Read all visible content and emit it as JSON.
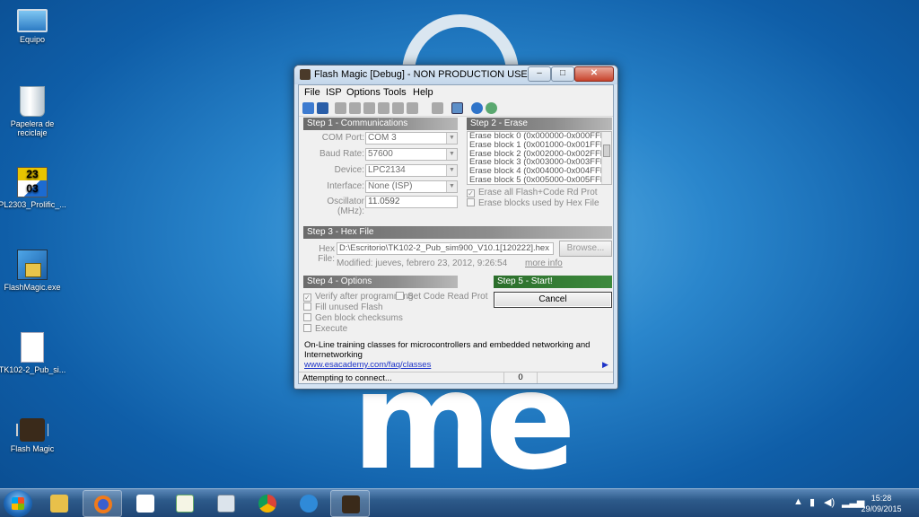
{
  "desktop": {
    "icons": [
      {
        "label": "Equipo"
      },
      {
        "label": "Papelera de reciclaje"
      },
      {
        "label": "PL2303_Prolific_...",
        "calendar_top": "23",
        "calendar_bottom": "03"
      },
      {
        "label": "FlashMagic.exe"
      },
      {
        "label": "TK102-2_Pub_si..."
      },
      {
        "label": "Flash Magic"
      }
    ],
    "wallpaper_text": "me"
  },
  "window": {
    "title": "Flash Magic [Debug] - NON PRODUCTION USE ONLY",
    "controls": {
      "minimize": "–",
      "maximize": "□",
      "close": "✕"
    },
    "menu": [
      "File",
      "ISP",
      "Options",
      "Tools",
      "Help"
    ],
    "toolbar_icons": [
      "open-icon",
      "save-icon",
      "search-icon",
      "blank-check-icon",
      "erase-icon",
      "verify-icon",
      "program-icon",
      "go-icon",
      "favorite-icon",
      "terminal-icon",
      "help-icon",
      "users-icon"
    ],
    "step1": {
      "title": "Step 1 - Communications",
      "com_port_label": "COM Port:",
      "com_port_value": "COM 3",
      "baud_label": "Baud Rate:",
      "baud_value": "57600",
      "device_label": "Device:",
      "device_value": "LPC2134",
      "interface_label": "Interface:",
      "interface_value": "None (ISP)",
      "osc_label": "Oscillator (MHz):",
      "osc_value": "11.0592"
    },
    "step2": {
      "title": "Step 2 - Erase",
      "blocks": [
        "Erase block 0 (0x000000-0x000FFF)",
        "Erase block 1 (0x001000-0x001FFF)",
        "Erase block 2 (0x002000-0x002FFF)",
        "Erase block 3 (0x003000-0x003FFF)",
        "Erase block 4 (0x004000-0x004FFF)",
        "Erase block 5 (0x005000-0x005FFF)"
      ],
      "erase_all_label": "Erase all Flash+Code Rd Prot",
      "erase_hex_label": "Erase blocks used by Hex File"
    },
    "step3": {
      "title": "Step 3 - Hex File",
      "hex_label": "Hex File:",
      "hex_value": "D:\\Escritorio\\TK102-2_Pub_sim900_V10.1[120222].hex",
      "browse_label": "Browse...",
      "modified_text": "Modified: jueves, febrero 23, 2012, 9:26:54",
      "more_info": "more info"
    },
    "step4": {
      "title": "Step 4 - Options",
      "verify_label": "Verify after programming",
      "code_read_label": "Set Code Read Prot",
      "fill_label": "Fill unused Flash",
      "checksums_label": "Gen block checksums",
      "execute_label": "Execute"
    },
    "step5": {
      "title": "Step 5 - Start!",
      "cancel_label": "Cancel"
    },
    "info": {
      "text": "On-Line training classes for microcontrollers and embedded networking and Internetworking",
      "link": "www.esacademy.com/faq/classes"
    },
    "status": {
      "text": "Attempting to connect...",
      "count": "0"
    }
  },
  "taskbar": {
    "apps": [
      "explorer-icon",
      "firefox-icon",
      "dropbox-icon",
      "editor-icon",
      "calculator-icon",
      "chrome-icon",
      "ie-icon",
      "flashmagic-icon"
    ],
    "clock_time": "15:28",
    "clock_date": "29/09/2015"
  },
  "colors": {
    "start_button": "#2f6a2f",
    "section_header": "#7a7a7a",
    "link": "#1d33c8"
  }
}
